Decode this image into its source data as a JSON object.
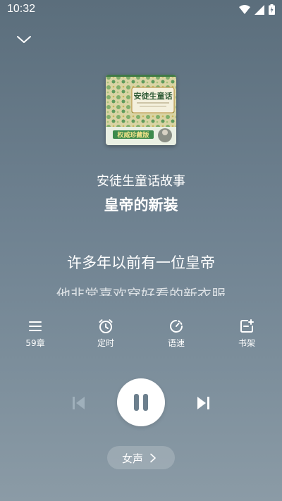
{
  "status": {
    "time": "10:32"
  },
  "book": {
    "title": "安徒生童话故事",
    "chapter": "皇帝的新装",
    "cover": {
      "title": "安徒生童话",
      "subtitle": "权威珍藏版"
    }
  },
  "lyrics": {
    "current": "许多年以前有一位皇帝",
    "next": "他非常喜欢穿好看的新衣服"
  },
  "toolbar": {
    "chapters_label": "59章",
    "timer_label": "定时",
    "speed_label": "语速",
    "bookshelf_label": "书架"
  },
  "player": {
    "state": "playing"
  },
  "voice": {
    "label": "女声"
  },
  "colors": {
    "background_top": "#5b6e7c",
    "background_bottom": "#8b9ba6",
    "play_icon": "#6c7f8d",
    "disabled_icon": "#9fb0bb"
  },
  "icons": {
    "collapse": "chevron-down-icon",
    "chapters": "list-icon",
    "timer": "alarm-clock-icon",
    "speed": "speed-icon",
    "bookshelf": "bookshelf-add-icon",
    "prev": "skip-previous-icon",
    "pause": "pause-icon",
    "next": "skip-next-icon"
  }
}
